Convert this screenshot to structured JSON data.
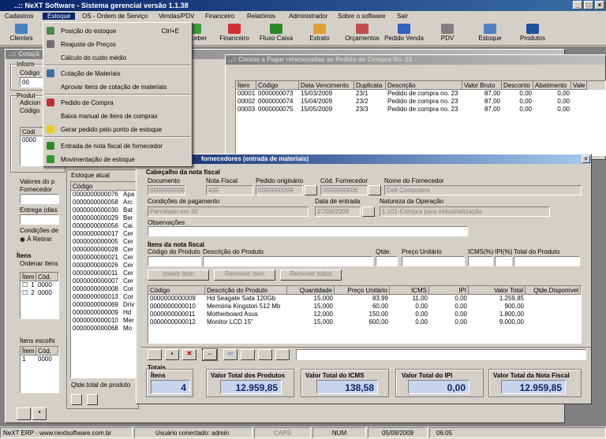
{
  "app": {
    "title": "..:: NeXT Software - Sistema gerencial versão 1.1.38"
  },
  "menubar": [
    "Cadastros",
    "Estoque",
    "OS - Ordem de Serviço",
    "Vendas/PDV",
    "Financeiro",
    "Relatórios",
    "Administrador",
    "Sobre o software",
    "Sair"
  ],
  "toolbar": [
    "Clientes",
    "Receber",
    "Financeiro",
    "Fluxo Caixa",
    "Extrato",
    "Orçamentos",
    "Pedido Venda",
    "PDV",
    "Estoque",
    "Produtos"
  ],
  "estoque_menu": [
    {
      "label": "Posição do estoque",
      "shortcut": "Ctrl+E",
      "icon": "chart-icon"
    },
    {
      "label": "Reajuste de Preços",
      "shortcut": "",
      "icon": "gear-icon"
    },
    {
      "label": "Cálculo do custo médio",
      "shortcut": "",
      "icon": ""
    },
    {
      "label": "Cotação de Materiais",
      "shortcut": "",
      "icon": "document-icon"
    },
    {
      "label": "Aprovar itens de cotação de materiais",
      "shortcut": "",
      "icon": ""
    },
    {
      "label": "Pedido de Compra",
      "shortcut": "",
      "icon": "cart-icon"
    },
    {
      "label": "Baixa manual de itens de compras",
      "shortcut": "",
      "icon": ""
    },
    {
      "label": "Gerar pedido pelo ponto de estoque",
      "shortcut": "",
      "icon": "bulb-icon"
    },
    {
      "label": "Entrada de nota fiscal de fornecedor",
      "shortcut": "",
      "icon": "invoice-icon"
    },
    {
      "label": "Movimentação de estoque",
      "shortcut": "",
      "icon": "refresh-icon"
    }
  ],
  "cotacao": {
    "title": "..:: Cotaçã",
    "informe": "Inform",
    "codigo": "Código",
    "codigo_value": "00",
    "produto": "Produt",
    "adicionar": "Adicion",
    "codigo2": "Código",
    "grid_header": "Códi",
    "grid_value": "0000",
    "valores": "Valores do p",
    "fornecedor": "Fornecedor",
    "entrega": "Entrega (dias",
    "condicoes": "Condições de",
    "a_retirar": "À Retirar",
    "itens": "Ítens",
    "ordenar": "Ordenar itens",
    "itens_grid_h": [
      "Ítem",
      "Cód."
    ],
    "itens_grid_rows": [
      [
        "1",
        "0000"
      ],
      [
        "2",
        "0000"
      ]
    ],
    "itens_escolhidos": "Ítens escolhi",
    "esc_grid_h": [
      "Ítem",
      "Cód."
    ],
    "esc_grid_rows": [
      [
        "1",
        "0000"
      ]
    ]
  },
  "estoque_atual": {
    "title": "Estoque atual",
    "header": "Código",
    "rows": [
      [
        "0000000000076",
        "Apa"
      ],
      [
        "0000000000058",
        "Arc"
      ],
      [
        "0000000000030",
        "Bat"
      ],
      [
        "0000000000029",
        "Ber"
      ],
      [
        "0000000000056",
        "Cai"
      ],
      [
        "0000000000017",
        "Cer"
      ],
      [
        "0000000000005",
        "Cer"
      ],
      [
        "0000000000028",
        "Cer"
      ],
      [
        "0000000000021",
        "Cer"
      ],
      [
        "0000000000026",
        "Cer"
      ],
      [
        "0000000000011",
        "Cer"
      ],
      [
        "0000000000007",
        "Cer"
      ],
      [
        "0000000000008",
        "Cor"
      ],
      [
        "0000000000013",
        "Cor"
      ],
      [
        "0000000000069",
        "Driv"
      ],
      [
        "0000000000009",
        "Hd"
      ],
      [
        "0000000000010",
        "Mer"
      ],
      [
        "0000000000068",
        "Mo"
      ]
    ],
    "footer": "Qtde.total de produto"
  },
  "contas": {
    "title": "..:: Contas a Pagar relacionadas ao Pedido de Compra No. 23",
    "headers": [
      "Ítem",
      "Código",
      "Data Vencimento",
      "Duplicata",
      "Descrição",
      "Valor Bruto",
      "Desconto",
      "Abatimento",
      "Vale"
    ],
    "rows": [
      [
        "00001",
        "0000000073",
        "15/03/2009",
        "23/1",
        "Pedido de compra no. 23",
        "87,00",
        "0,00",
        "0,00"
      ],
      [
        "00002",
        "0000000074",
        "15/04/2009",
        "23/2",
        "Pedido de compra no. 23",
        "87,00",
        "0,00",
        "0,00"
      ],
      [
        "00003",
        "0000000075",
        "15/05/2009",
        "23/3",
        "Pedido de compra no. 23",
        "87,00",
        "0,00",
        "0,00"
      ]
    ]
  },
  "nf": {
    "title": "fornecedores (entrada de materiais)",
    "cabecalho": "Cabeçalho da nota fiscal",
    "documento_lbl": "Documento",
    "documento": "0000000008",
    "nota_lbl": "Nota Fiscal",
    "nota": "435",
    "pedido_lbl": "Pedido originário",
    "pedido": "0000000009",
    "codforn_lbl": "Cód. Fornecedor",
    "codforn": "0000000006",
    "nomeforn_lbl": "Nome do Fornecedor",
    "nomeforn": "Dell Computers",
    "condpag_lbl": "Condições de pagamento",
    "condpag": "Parcelado em 3X",
    "dataent_lbl": "Data de entrada",
    "dataent": "27/09/2008",
    "natureza_lbl": "Natureza da Operação",
    "natureza": "1.101-Compra para industrialização",
    "obs_lbl": "Observações",
    "itens_lbl": "Ítens da nota fiscal",
    "cod_prod_lbl": "Código do Produto",
    "desc_prod_lbl": "Descrição do Produto",
    "qtde_lbl": "Qtde.",
    "preco_lbl": "Preço Unitário",
    "icms_lbl": "ICMS(%)",
    "ipi_lbl": "IPI(%)",
    "total_lbl": "Total do Produto",
    "inserir": "Inserir ítem",
    "remover": "Remover ítem",
    "remover_todos": "Remover todos",
    "grid_headers": [
      "Código",
      "Descrição do Produto",
      "Quantidade",
      "Preço Unitário",
      "ICMS",
      "IPI",
      "Valor Total",
      "Qtde.Disponível"
    ],
    "grid_rows": [
      [
        "0000000000009",
        "Hd Seagate Sata 120Gb",
        "15,000",
        "83,99",
        "11,00",
        "0,00",
        "1.259,85",
        ""
      ],
      [
        "0000000000010",
        "Memória Kingston 512 Mb",
        "15,000",
        "60,00",
        "0,00",
        "0,00",
        "900,00",
        ""
      ],
      [
        "0000000000011",
        "Motherboard Asus",
        "12,000",
        "150,00",
        "0,00",
        "0,00",
        "1.800,00",
        ""
      ],
      [
        "0000000000012",
        "Monitor LCD 15\"",
        "15,000",
        "600,00",
        "0,00",
        "0,00",
        "9.000,00",
        ""
      ]
    ],
    "totais_lbl": "Totais",
    "t_itens_lbl": "Ítens",
    "t_itens": "4",
    "t_prod_lbl": "Valor Total dos Produtos",
    "t_prod": "12.959,85",
    "t_icms_lbl": "Valor Total do ICMS",
    "t_icms": "138,58",
    "t_ipi_lbl": "Valor Total do IPI",
    "t_ipi": "0,00",
    "t_nf_lbl": "Valor Total da Nota Fiscal",
    "t_nf": "12.959,85"
  },
  "status": {
    "site": "NeXT ERP - www.nextsoftware.com.br",
    "user": "Usuário conectado: admin",
    "caps": "CAPS",
    "num": "NUM",
    "date": "05/09/2009",
    "time": "06:05"
  },
  "colors": {
    "title": "#0a246a",
    "accent": "#3a6ea5",
    "face": "#d4d0c8"
  }
}
